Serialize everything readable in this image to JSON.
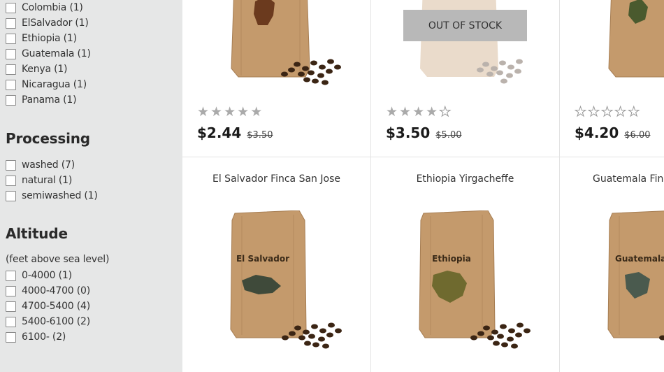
{
  "sidebar": {
    "origin_filters": [
      {
        "label": "Colombia (1)"
      },
      {
        "label": "ElSalvador (1)"
      },
      {
        "label": "Ethiopia (1)"
      },
      {
        "label": "Guatemala (1)"
      },
      {
        "label": "Kenya (1)"
      },
      {
        "label": "Nicaragua (1)"
      },
      {
        "label": "Panama (1)"
      }
    ],
    "processing": {
      "title": "Processing",
      "options": [
        {
          "label": "washed (7)"
        },
        {
          "label": "natural (1)"
        },
        {
          "label": "semiwashed (1)"
        }
      ]
    },
    "altitude": {
      "title": "Altitude",
      "note": "(feet above sea level)",
      "options": [
        {
          "label": "0-4000 (1)"
        },
        {
          "label": "4000-4700 (0)"
        },
        {
          "label": "4700-5400 (4)"
        },
        {
          "label": "5400-6100 (2)"
        },
        {
          "label": "6100- (2)"
        }
      ]
    }
  },
  "products_top_row": [
    {
      "rating": 5,
      "price": "$2.44",
      "old_price": "$3.50",
      "map_color": "#6b3a1e"
    },
    {
      "rating": 4,
      "price": "$3.50",
      "old_price": "$5.00",
      "badge": "OUT OF STOCK"
    },
    {
      "rating": 0,
      "price": "$4.20",
      "old_price": "$6.00",
      "map_color": "#4a5a2e"
    }
  ],
  "products_bottom_row": [
    {
      "name": "El Salvador Finca San Jose",
      "bag_label": "El Salvador",
      "map_color": "#3f4a3a"
    },
    {
      "name": "Ethiopia Yirgacheffe",
      "bag_label": "Ethiopia",
      "map_color": "#6f6a2f"
    },
    {
      "name": "Guatemala Finca",
      "bag_label": "Guatemala",
      "map_color": "#4a5a4e"
    }
  ]
}
